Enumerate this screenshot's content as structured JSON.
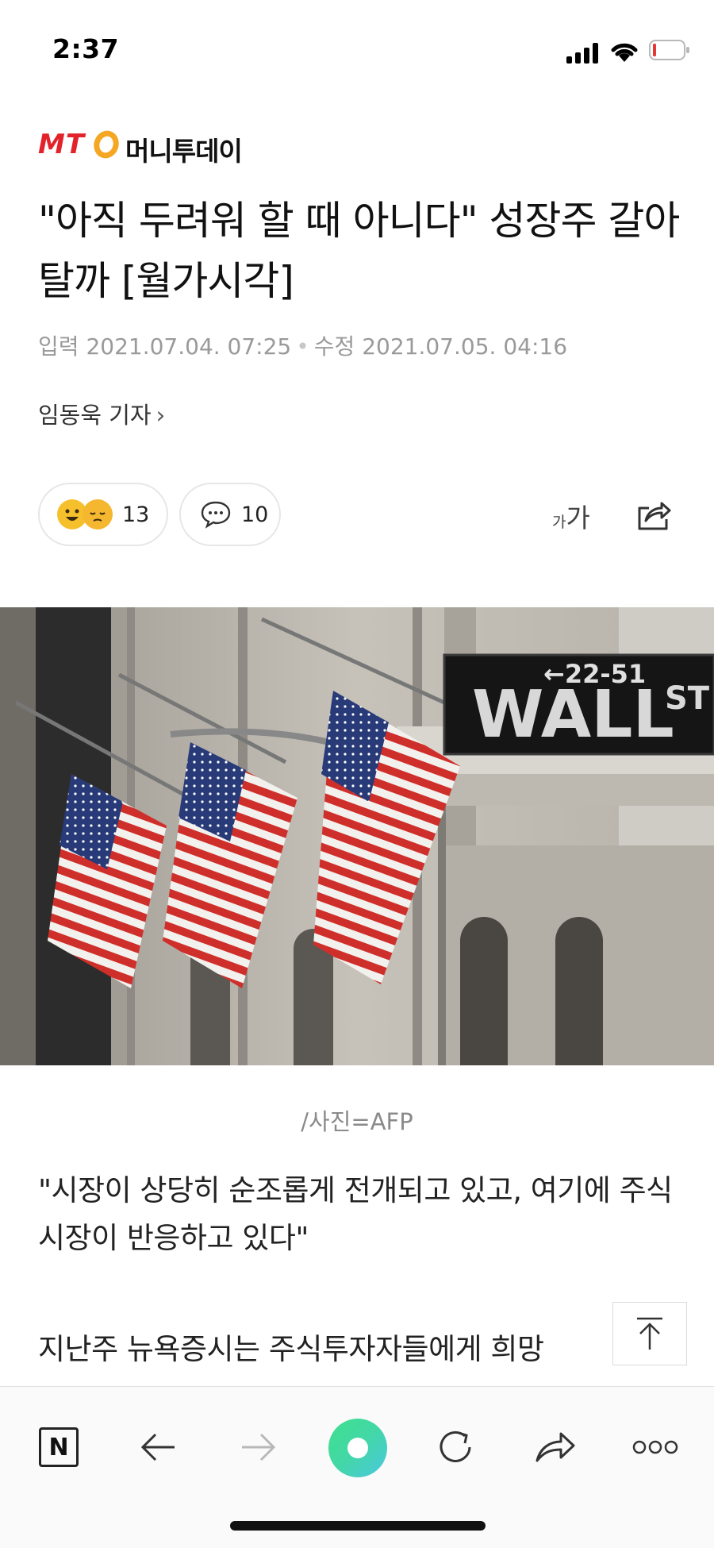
{
  "status_bar": {
    "time": "2:37"
  },
  "publisher": {
    "logo_mark": "MTO",
    "name": "머니투데이"
  },
  "article": {
    "headline": "\"아직 두려워 할 때 아니다\" 성장주 갈아탈까 [월가시각]",
    "input_label": "입력",
    "input_date": "2021.07.04. 07:25",
    "edit_label": "수정",
    "edit_date": "2021.07.05. 04:16",
    "author": "임동욱 기자",
    "author_chevron": "›",
    "reaction_count": "13",
    "comment_count": "10",
    "font_small": "가",
    "font_big": "가",
    "photo_caption": "/사진=AFP",
    "photo_sign_top": "←22-51",
    "photo_sign_main": "WALL",
    "photo_sign_st": "ST",
    "paragraph1": "\"시장이 상당히 순조롭게 전개되고 있고, 여기에 주식시장이 반응하고 있다\"",
    "paragraph2": "지난주 뉴욕증시는 주식투자자들에게 희망"
  },
  "toolbar": {
    "n_label": "N"
  },
  "icons": {
    "reaction": "smile-emoji-icon",
    "comment": "speech-bubble-icon",
    "share": "share-icon",
    "scroll_top": "arrow-up-icon",
    "back": "arrow-left-icon",
    "forward": "arrow-right-icon",
    "refresh": "refresh-icon",
    "more": "more-dots-icon"
  },
  "colors": {
    "brand_red": "#e3232b",
    "brand_orange": "#f5a623",
    "meta_gray": "#9a9a9a"
  }
}
